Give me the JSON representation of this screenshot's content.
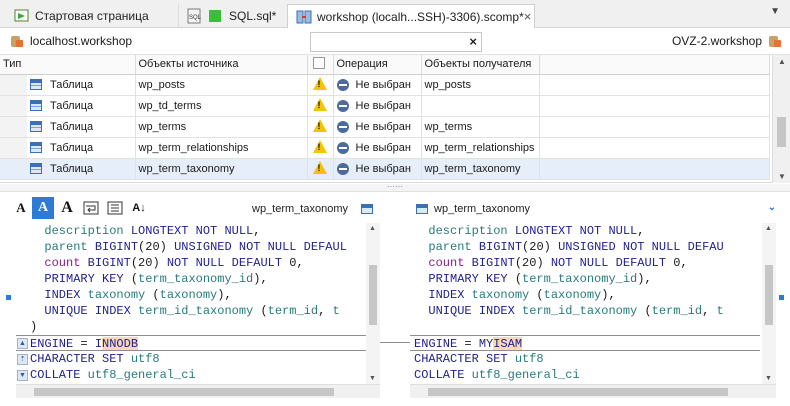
{
  "tabs": [
    {
      "label": "Стартовая страница",
      "icon": "start-page-icon",
      "active": false
    },
    {
      "label": "SQL.sql*",
      "icon": "sql-file-icon",
      "active": false
    },
    {
      "label": "workshop (localh...SSH)-3306).scomp*",
      "icon": "schema-compare-icon",
      "active": true
    }
  ],
  "tab_close_glyph": "×",
  "tab_menu_glyph": "▼",
  "connection": {
    "source": "localhost.workshop",
    "target": "OVZ-2.workshop",
    "filter_value": "",
    "filter_clear_glyph": "×"
  },
  "grid": {
    "columns": [
      "Тип",
      "Объекты источника",
      "",
      "Операция",
      "Объекты получателя"
    ],
    "rows": [
      {
        "type": "Таблица",
        "source": "wp_posts",
        "operation": "Не выбран",
        "target": "wp_posts",
        "selected": false
      },
      {
        "type": "Таблица",
        "source": "wp_td_terms",
        "operation": "Не выбран",
        "target": "",
        "selected": false
      },
      {
        "type": "Таблица",
        "source": "wp_terms",
        "operation": "Не выбран",
        "target": "wp_terms",
        "selected": false
      },
      {
        "type": "Таблица",
        "source": "wp_term_relationships",
        "operation": "Не выбран",
        "target": "wp_term_relationships",
        "selected": false
      },
      {
        "type": "Таблица",
        "source": "wp_term_taxonomy",
        "operation": "Не выбран",
        "target": "wp_term_taxonomy",
        "selected": true
      }
    ]
  },
  "splitter_glyph": "⋯⋯",
  "compare_toolbar": {
    "font_buttons": [
      "A",
      "A",
      "A"
    ],
    "sort_label": "A↓",
    "left_object": "wp_term_taxonomy",
    "right_object": "wp_term_taxonomy",
    "collapse_glyph": "⌄"
  },
  "diff": {
    "left_lines": [
      "  description LONGTEXT NOT NULL,",
      "  parent BIGINT(20) UNSIGNED NOT NULL DEFAUL",
      "  count BIGINT(20) NOT NULL DEFAULT 0,",
      "  PRIMARY KEY (term_taxonomy_id),",
      "  INDEX taxonomy (taxonomy),",
      "  UNIQUE INDEX term_id_taxonomy (term_id, t",
      ")",
      "ENGINE = INNODB",
      "CHARACTER SET utf8",
      "COLLATE utf8_general_ci"
    ],
    "right_lines": [
      "  description LONGTEXT NOT NULL,",
      "  parent BIGINT(20) UNSIGNED NOT NULL DEFAU",
      "  count BIGINT(20) NOT NULL DEFAULT 0,",
      "  PRIMARY KEY (term_taxonomy_id),",
      "  INDEX taxonomy (taxonomy),",
      "  UNIQUE INDEX term_id_taxonomy (term_id, t",
      "",
      "ENGINE = MYISAM",
      "CHARACTER SET utf8",
      "COLLATE utf8_general_ci"
    ],
    "left_engine": "INNODB",
    "right_engine": "MYISAM"
  },
  "colors": {
    "accent": "#2e7bd6",
    "selected_row": "#e6eefa",
    "warning": "#f5c400",
    "diff_highlight": "#f7d8b8"
  }
}
